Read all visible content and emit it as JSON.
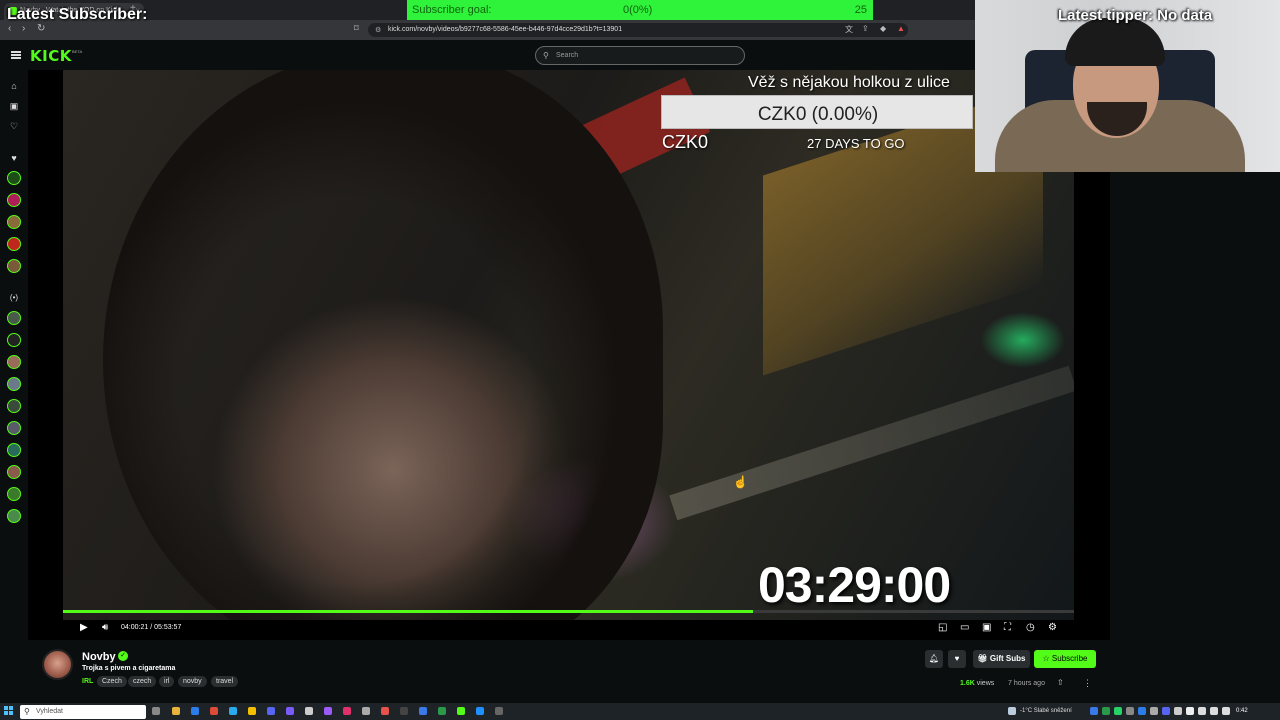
{
  "browser": {
    "tab_title": "Novby - Watch the VOD on Kick",
    "url": "kick.com/novby/videos/b9277c68-5586-45ee-b446-97d4cce29d1b?t=13901"
  },
  "overlay": {
    "latest_subscriber_label": "Latest Subscriber:",
    "subscriber_goal_label": "Subscriber goal:",
    "subscriber_goal_progress": "0(0%)",
    "subscriber_goal_target": "25",
    "latest_tipper_label": "Latest tipper: No data"
  },
  "header": {
    "logo": "KICK",
    "beta": "BETA",
    "search_placeholder": "Search"
  },
  "video_overlay": {
    "goal_title": "Věž s nějakou holkou z ulice",
    "goal_bar_text": "CZK0 (0.00%)",
    "goal_current": "CZK0",
    "goal_days": "27 DAYS TO GO",
    "timer": "03:29:00"
  },
  "player": {
    "time_display": "04:00:21 / 05:53:57",
    "progress_fraction": 0.682
  },
  "stream": {
    "streamer_name": "Novby",
    "title": "Trojka s pivem a cigaretama",
    "category": "IRL",
    "tags": [
      "Czech",
      "czech",
      "irl",
      "novby",
      "travel"
    ],
    "gift_subs_label": "Gift Subs",
    "subscribe_label": "Subscribe",
    "views_count": "1.6K",
    "views_label": "views",
    "time_ago": "7 hours ago"
  },
  "taskbar": {
    "search_placeholder": "Vyhledat",
    "weather": "-1°C  Slabé sněžení",
    "clock": "0:42"
  },
  "colors": {
    "kick_green": "#53fc18",
    "background": "#0b0e0f"
  }
}
